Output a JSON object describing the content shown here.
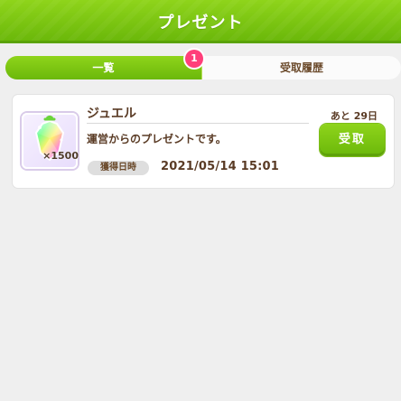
{
  "header": {
    "title": "プレゼント"
  },
  "tabs": [
    {
      "label": "一覧",
      "state": "active"
    },
    {
      "label": "受取履歴",
      "state": "inactive"
    }
  ],
  "badge": {
    "count": "1"
  },
  "present_item": {
    "name": "ジュエル",
    "description": "運営からのプレゼントです。",
    "quantity": "×1500",
    "acquired_label": "獲得日時",
    "acquired_datetime": "2021/05/14 15:01",
    "remaining": "あと 29日",
    "claim_label": "受取",
    "icon": "jewel-icon"
  },
  "colors": {
    "accent_green": "#7cc615",
    "badge_pink": "#ff3f7a",
    "text_brown": "#5a3b25",
    "background": "#efefef"
  }
}
